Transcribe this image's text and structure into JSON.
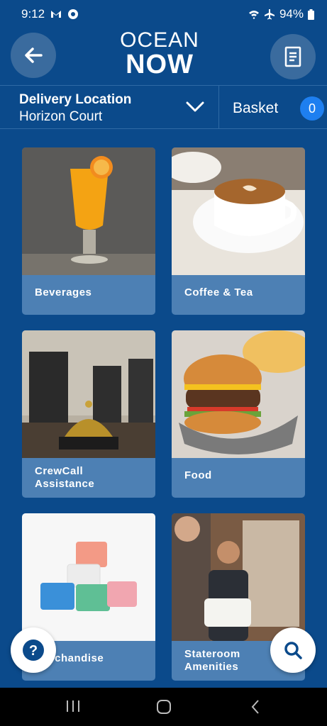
{
  "status_bar": {
    "time": "9:12",
    "battery": "94%"
  },
  "header": {
    "logo_top": "OCEAN",
    "logo_bottom": "NOW"
  },
  "delivery": {
    "label": "Delivery Location",
    "value": "Horizon Court"
  },
  "basket": {
    "label": "Basket",
    "count": "0"
  },
  "categories": [
    {
      "label": "Beverages"
    },
    {
      "label": "Coffee & Tea"
    },
    {
      "label_line1": "CrewCall",
      "label_line2": "Assistance"
    },
    {
      "label": "Food"
    },
    {
      "label": "Merchandise"
    },
    {
      "label_line1": "Stateroom",
      "label_line2": "Amenities"
    }
  ],
  "colors": {
    "background": "#0b4a8b",
    "card_label_bg": "#4d80b4",
    "badge": "#1e7ff0"
  },
  "icons": [
    "back-arrow-icon",
    "receipt-icon",
    "chevron-down-icon",
    "help-icon",
    "search-icon"
  ]
}
